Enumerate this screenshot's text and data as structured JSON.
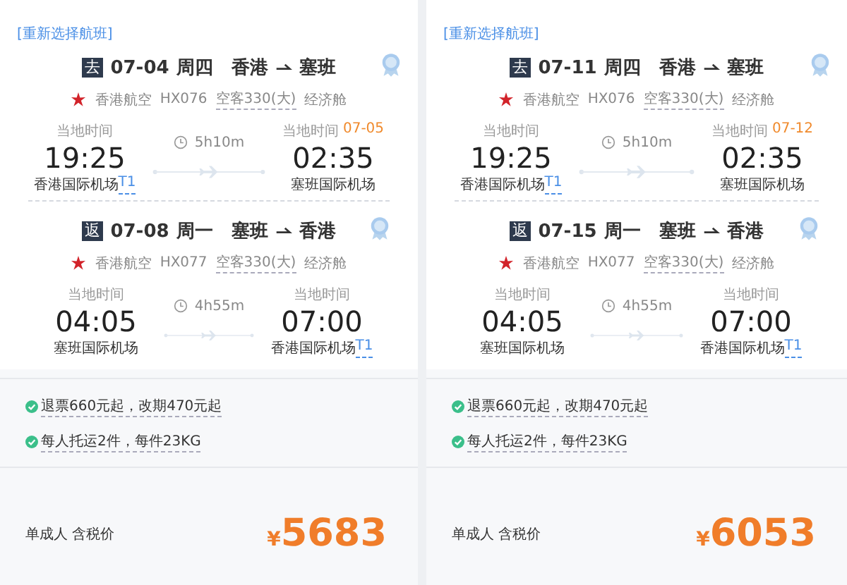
{
  "panels": [
    {
      "reselect_link": "[重新选择航班]",
      "legs": [
        {
          "tag": "去",
          "date": "07-04",
          "weekday": "周四",
          "from": "香港",
          "to": "塞班",
          "airline": "香港航空",
          "flight": "HX076",
          "aircraft": "空客330(大)",
          "cabin": "经济舱",
          "duration": "5h10m",
          "depart": {
            "label": "当地时间",
            "time": "19:25",
            "airport": "香港国际机场",
            "terminal": "T1"
          },
          "arrive": {
            "label": "当地时间",
            "next_date": "07-05",
            "time": "02:35",
            "airport": "塞班国际机场"
          }
        },
        {
          "tag": "返",
          "date": "07-08",
          "weekday": "周一",
          "from": "塞班",
          "to": "香港",
          "airline": "香港航空",
          "flight": "HX077",
          "aircraft": "空客330(大)",
          "cabin": "经济舱",
          "duration": "4h55m",
          "depart": {
            "label": "当地时间",
            "time": "04:05",
            "airport": "塞班国际机场"
          },
          "arrive": {
            "label": "当地时间",
            "time": "07:00",
            "airport": "香港国际机场",
            "terminal": "T1"
          }
        }
      ],
      "policies": [
        "退票660元起，改期470元起",
        "每人托运2件，每件23KG"
      ],
      "price_label": "单成人 含税价",
      "currency": "¥",
      "price": "5683"
    },
    {
      "reselect_link": "[重新选择航班]",
      "legs": [
        {
          "tag": "去",
          "date": "07-11",
          "weekday": "周四",
          "from": "香港",
          "to": "塞班",
          "airline": "香港航空",
          "flight": "HX076",
          "aircraft": "空客330(大)",
          "cabin": "经济舱",
          "duration": "5h10m",
          "depart": {
            "label": "当地时间",
            "time": "19:25",
            "airport": "香港国际机场",
            "terminal": "T1"
          },
          "arrive": {
            "label": "当地时间",
            "next_date": "07-12",
            "time": "02:35",
            "airport": "塞班国际机场"
          }
        },
        {
          "tag": "返",
          "date": "07-15",
          "weekday": "周一",
          "from": "塞班",
          "to": "香港",
          "airline": "香港航空",
          "flight": "HX077",
          "aircraft": "空客330(大)",
          "cabin": "经济舱",
          "duration": "4h55m",
          "depart": {
            "label": "当地时间",
            "time": "04:05",
            "airport": "塞班国际机场"
          },
          "arrive": {
            "label": "当地时间",
            "time": "07:00",
            "airport": "香港国际机场",
            "terminal": "T1"
          }
        }
      ],
      "policies": [
        "退票660元起，改期470元起",
        "每人托运2件，每件23KG"
      ],
      "price_label": "单成人 含税价",
      "currency": "¥",
      "price": "6053"
    }
  ]
}
